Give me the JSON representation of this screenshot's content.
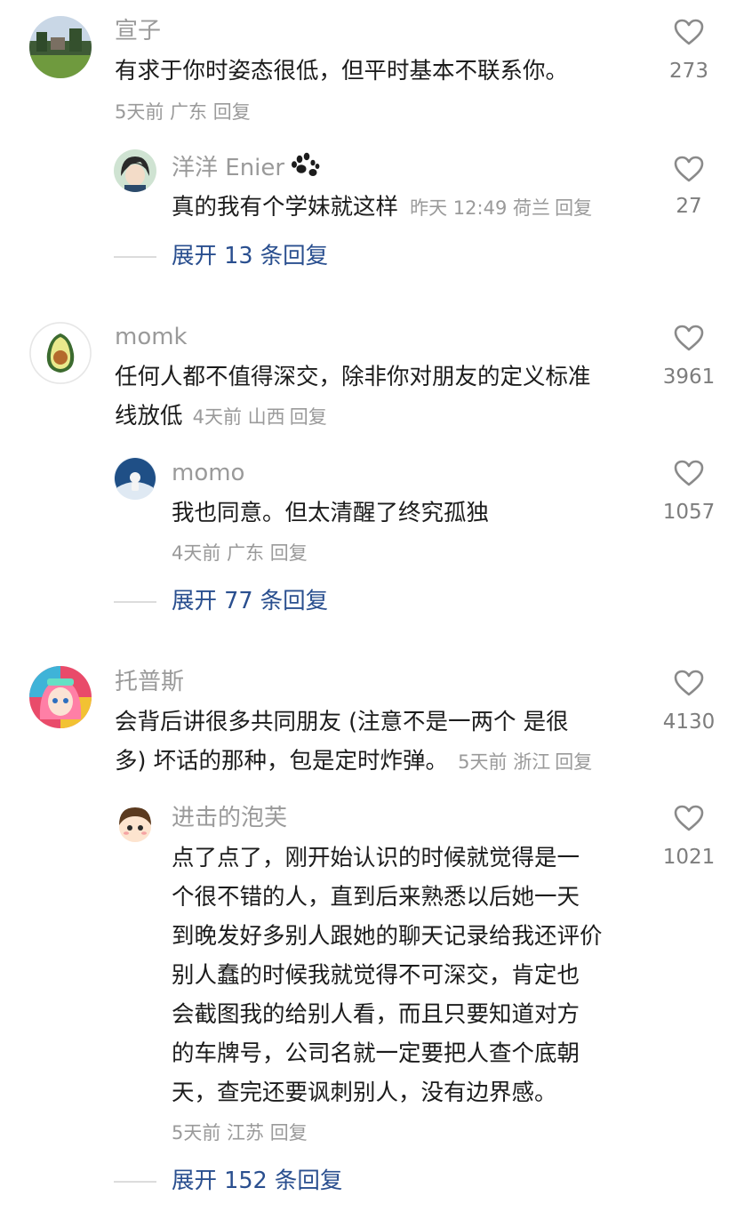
{
  "comments": [
    {
      "author": "宣子",
      "text": "有求于你时姿态很低，但平时基本不联系你。",
      "meta": "5天前 广东",
      "reply_label": "回复",
      "likes": "273",
      "reply": {
        "author": "洋洋 Enier",
        "text": "真的我有个学妹就这样",
        "meta": "昨天 12:49 荷兰",
        "reply_label": "回复",
        "likes": "27"
      },
      "expand_label": "展开 13 条回复"
    },
    {
      "author": "momk",
      "text_lines": [
        "任何人都不值得深交，除非你对朋友的定义标准",
        "线放低"
      ],
      "meta": "4天前 山西",
      "reply_label": "回复",
      "likes": "3961",
      "reply": {
        "author": "momo",
        "text": "我也同意。但太清醒了终究孤独",
        "meta": "4天前 广东",
        "reply_label": "回复",
        "likes": "1057"
      },
      "expand_label": "展开 77 条回复"
    },
    {
      "author": "托普斯",
      "text_lines": [
        "会背后讲很多共同朋友 (注意不是一两个 是很",
        "多) 坏话的那种，包是定时炸弹。"
      ],
      "meta": "5天前 浙江",
      "reply_label": "回复",
      "likes": "4130",
      "reply": {
        "author": "进击的泡芙",
        "text_lines": [
          "点了点了，刚开始认识的时候就觉得是一",
          "个很不错的人，直到后来熟悉以后她一天",
          "到晚发好多别人跟她的聊天记录给我还评价",
          "别人蠢的时候我就觉得不可深交，肯定也",
          "会截图我的给别人看，而且只要知道对方",
          "的车牌号，公司名就一定要把人查个底朝",
          "天，查完还要讽刺别人，没有边界感。"
        ],
        "meta": "5天前 江苏",
        "reply_label": "回复",
        "likes": "1021"
      },
      "expand_label": "展开 152 条回复"
    }
  ],
  "colors": {
    "name": "#9a9a9a",
    "text": "#1c1c1c",
    "meta": "#9a9a9a",
    "link": "#2a4f8f",
    "heart_stroke": "#8a8a8a"
  },
  "icons": {
    "like": "heart-outline-icon",
    "badge": "paw-print-icon"
  }
}
